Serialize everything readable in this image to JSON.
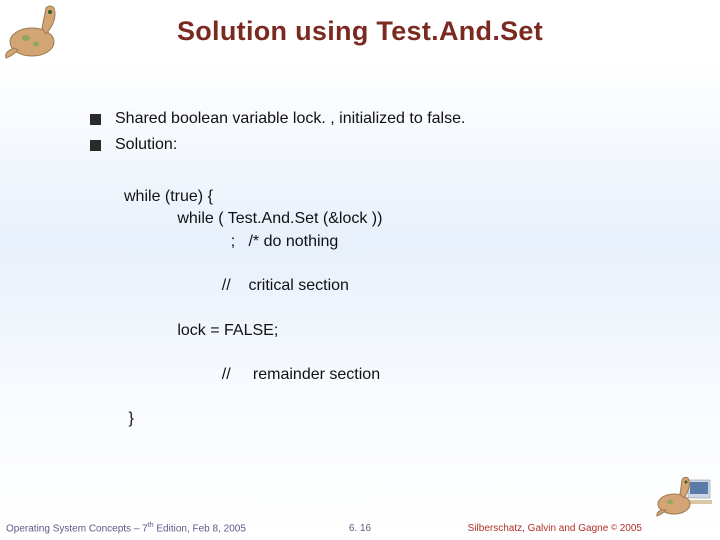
{
  "title": "Solution using Test.And.Set",
  "bullets": {
    "b1": "Shared boolean variable lock. , initialized to false.",
    "b2": "Solution:"
  },
  "code": {
    "l1": "while (true) {",
    "l2": "            while ( Test.And.Set (&lock ))",
    "l3": "                        ;   /* do nothing",
    "l4": "                      //    critical section",
    "l5": "            lock = FALSE;",
    "l6": "                      //     remainder section ",
    "l7": " }"
  },
  "footer": {
    "left_a": "Operating System Concepts – 7",
    "left_sup": "th",
    "left_b": " Edition, Feb 8, 2005",
    "center": "6. 16",
    "right_a": "Silberschatz, Galvin and Gagne ",
    "right_copy": "©",
    "right_b": " 2005"
  }
}
